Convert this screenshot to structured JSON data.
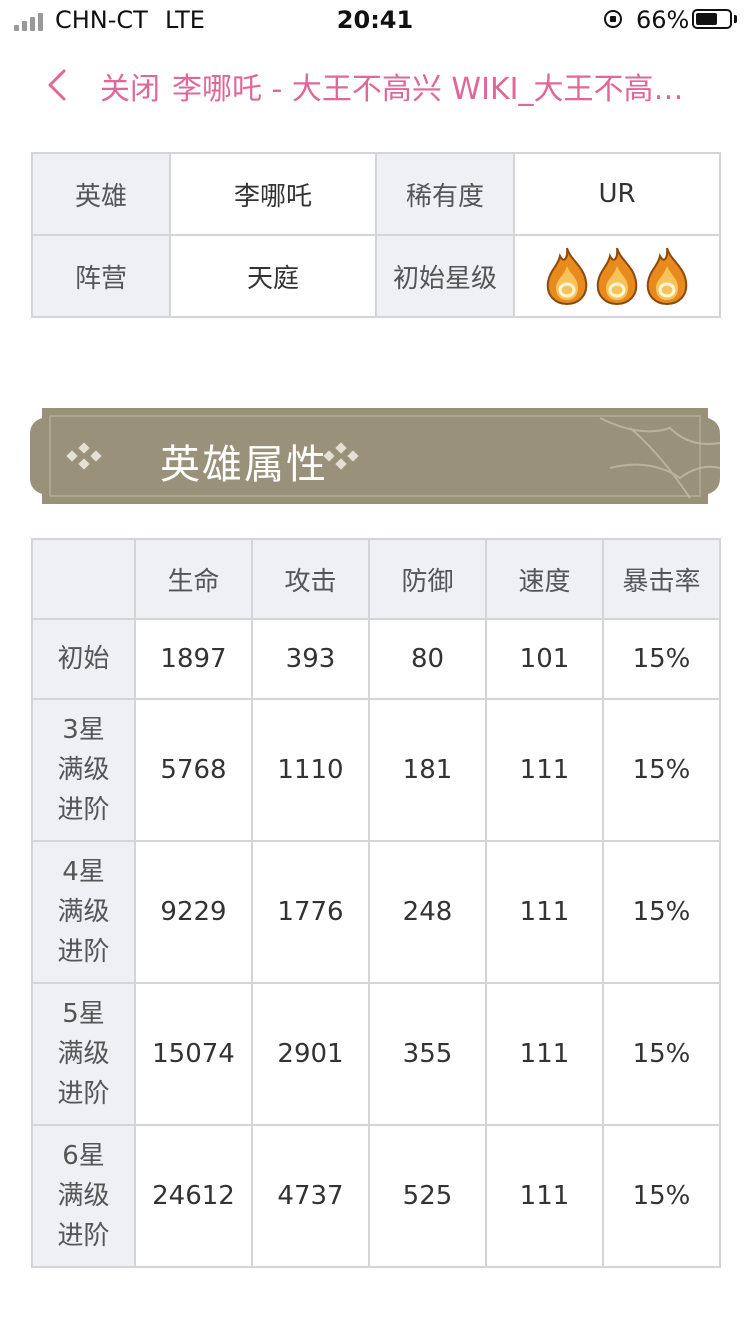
{
  "status_bar": {
    "carrier": "CHN-CT",
    "network": "LTE",
    "time": "20:41",
    "battery": "66%",
    "battery_level": 0.66
  },
  "nav": {
    "close_label": "关闭",
    "title": "李哪吒 - 大王不高兴 WIKI_大王不高兴攻略"
  },
  "info": {
    "rows": [
      {
        "label1": "英雄",
        "value1": "李哪吒",
        "label2": "稀有度",
        "value2": "UR"
      },
      {
        "label1": "阵营",
        "value1": "天庭",
        "label2": "初始星级",
        "value2_icon": "flame-icon",
        "value2_count": 3
      }
    ]
  },
  "banner": {
    "title": "英雄属性"
  },
  "stats": {
    "columns": [
      "",
      "生命",
      "攻击",
      "防御",
      "速度",
      "暴击率"
    ],
    "rows": [
      {
        "label": "初始",
        "values": [
          "1897",
          "393",
          "80",
          "101",
          "15%"
        ]
      },
      {
        "label": "3星满级进阶",
        "values": [
          "5768",
          "1110",
          "181",
          "111",
          "15%"
        ]
      },
      {
        "label": "4星满级进阶",
        "values": [
          "9229",
          "1776",
          "248",
          "111",
          "15%"
        ]
      },
      {
        "label": "5星满级进阶",
        "values": [
          "15074",
          "2901",
          "355",
          "111",
          "15%"
        ]
      },
      {
        "label": "6星满级进阶",
        "values": [
          "24612",
          "4737",
          "525",
          "111",
          "15%"
        ]
      }
    ]
  },
  "colors": {
    "accent": "#e0679a",
    "banner": "#9a917b",
    "header_bg": "#eef0f4",
    "border": "#d5d5d9"
  }
}
